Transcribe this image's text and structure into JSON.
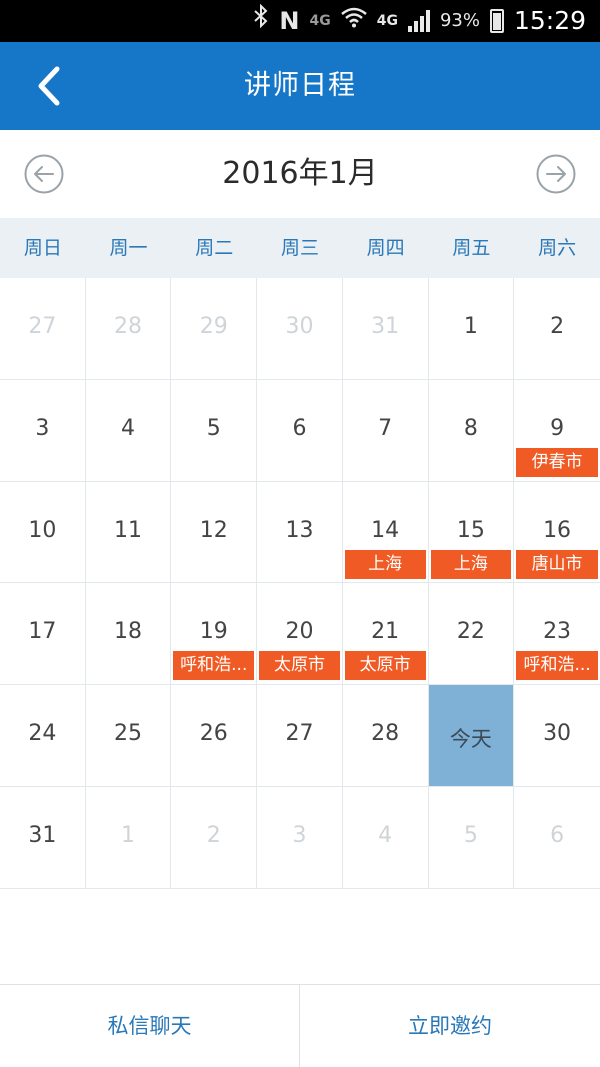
{
  "status_bar": {
    "bluetooth_icon": "bluetooth-icon",
    "nfc_label": "N",
    "network_4g_small": "4G",
    "wifi_icon": "wifi-icon",
    "network_4g": "4G",
    "signal_icon": "signal-icon",
    "battery": "93%",
    "time": "15:29"
  },
  "header": {
    "title": "讲师日程",
    "back_icon": "chevron-left-icon"
  },
  "month_nav": {
    "title": "2016年1月",
    "prev_icon": "circle-arrow-left-icon",
    "next_icon": "circle-arrow-right-icon"
  },
  "weekdays": [
    "周日",
    "周一",
    "周二",
    "周三",
    "周四",
    "周五",
    "周六"
  ],
  "weeks": [
    [
      {
        "day": "27",
        "muted": true
      },
      {
        "day": "28",
        "muted": true
      },
      {
        "day": "29",
        "muted": true
      },
      {
        "day": "30",
        "muted": true
      },
      {
        "day": "31",
        "muted": true
      },
      {
        "day": "1"
      },
      {
        "day": "2"
      }
    ],
    [
      {
        "day": "3"
      },
      {
        "day": "4"
      },
      {
        "day": "5"
      },
      {
        "day": "6"
      },
      {
        "day": "7"
      },
      {
        "day": "8"
      },
      {
        "day": "9",
        "event": "伊春市"
      }
    ],
    [
      {
        "day": "10"
      },
      {
        "day": "11"
      },
      {
        "day": "12"
      },
      {
        "day": "13"
      },
      {
        "day": "14",
        "event": "上海"
      },
      {
        "day": "15",
        "event": "上海"
      },
      {
        "day": "16",
        "event": "唐山市"
      }
    ],
    [
      {
        "day": "17"
      },
      {
        "day": "18"
      },
      {
        "day": "19",
        "event": "呼和浩..."
      },
      {
        "day": "20",
        "event": "太原市"
      },
      {
        "day": "21",
        "event": "太原市"
      },
      {
        "day": "22"
      },
      {
        "day": "23",
        "event": "呼和浩..."
      }
    ],
    [
      {
        "day": "24"
      },
      {
        "day": "25"
      },
      {
        "day": "26"
      },
      {
        "day": "27"
      },
      {
        "day": "28"
      },
      {
        "day": "今天",
        "today": true
      },
      {
        "day": "30"
      }
    ],
    [
      {
        "day": "31"
      },
      {
        "day": "1",
        "muted": true
      },
      {
        "day": "2",
        "muted": true
      },
      {
        "day": "3",
        "muted": true
      },
      {
        "day": "4",
        "muted": true
      },
      {
        "day": "5",
        "muted": true
      },
      {
        "day": "6",
        "muted": true
      }
    ]
  ],
  "bottom": {
    "chat_label": "私信聊天",
    "invite_label": "立即邀约"
  },
  "colors": {
    "header_bg": "#1677c9",
    "event_tag": "#f05a24",
    "today_bg": "#7fb1d6",
    "accent_text": "#2a78b8"
  }
}
